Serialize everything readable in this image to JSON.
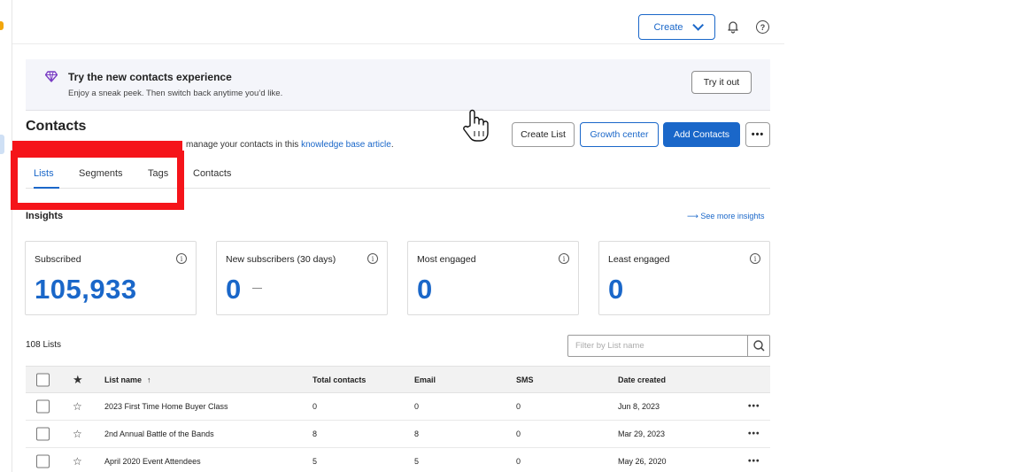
{
  "topbar": {
    "create_label": "Create",
    "help_glyph": "?"
  },
  "banner": {
    "title": "Try the new contacts experience",
    "subtitle": "Enjoy a sneak peek. Then switch back anytime you’d like.",
    "try_label": "Try it out",
    "icon": "diamond-icon"
  },
  "header": {
    "title": "Contacts",
    "desc_prefix": "manage your contacts in this ",
    "desc_link": "knowledge base article",
    "desc_suffix": ".",
    "buttons": {
      "create_list": "Create List",
      "growth_center": "Growth center",
      "add_contacts": "Add Contacts",
      "more": "•••"
    }
  },
  "tabs": [
    "Lists",
    "Segments",
    "Tags",
    "Contacts"
  ],
  "insights": {
    "title": "Insights",
    "see_more": "⟶ See more insights",
    "cards": [
      {
        "label": "Subscribed",
        "value": "105,933"
      },
      {
        "label": "New subscribers (30 days)",
        "value": "0"
      },
      {
        "label": "Most engaged",
        "value": "0"
      },
      {
        "label": "Least engaged",
        "value": "0"
      }
    ]
  },
  "lists": {
    "count": "108 Lists",
    "filter_placeholder": "Filter by List name",
    "columns": {
      "name": "List name",
      "sort_glyph": "↑",
      "total": "Total contacts",
      "email": "Email",
      "sms": "SMS",
      "date": "Date created"
    },
    "rows": [
      {
        "name": "2023 First Time Home Buyer Class",
        "total": "0",
        "email": "0",
        "sms": "0",
        "date": "Jun 8, 2023"
      },
      {
        "name": "2nd Annual Battle of the Bands",
        "total": "8",
        "email": "8",
        "sms": "0",
        "date": "Mar 29, 2023"
      },
      {
        "name": "April 2020 Event Attendees",
        "total": "5",
        "email": "5",
        "sms": "0",
        "date": "May 26, 2020"
      }
    ],
    "row_more": "•••"
  },
  "colors": {
    "accent": "#1a67c9",
    "annotation": "#f5141a"
  }
}
